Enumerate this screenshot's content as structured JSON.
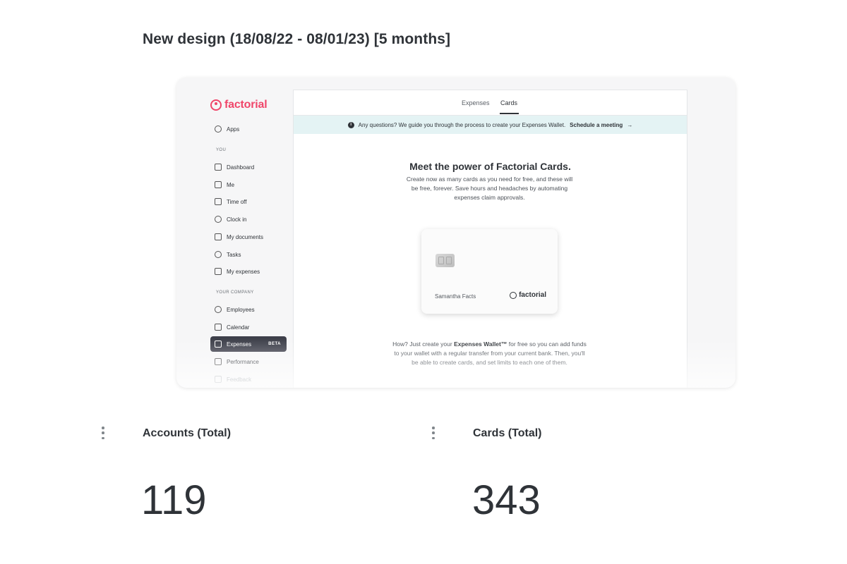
{
  "page": {
    "title": "New design (18/08/22 - 08/01/23) [5 months]"
  },
  "embedded_screenshot": {
    "brand": "factorial",
    "sidebar": {
      "top_item": "Apps",
      "section_you": "YOU",
      "you_items": [
        "Dashboard",
        "Me",
        "Time off",
        "Clock in",
        "My documents",
        "Tasks",
        "My expenses"
      ],
      "section_company": "YOUR COMPANY",
      "company_items": [
        "Employees",
        "Calendar",
        "Expenses",
        "Performance",
        "Feedback"
      ],
      "active_item": "Expenses",
      "active_badge": "BETA"
    },
    "tabs": [
      "Expenses",
      "Cards"
    ],
    "active_tab": "Cards",
    "banner": {
      "text": "Any questions? We guide you through the process to create your Expenses Wallet.",
      "link": "Schedule a meeting",
      "link_arrow": "→"
    },
    "hero": {
      "title": "Meet the power of Factorial Cards.",
      "body": "Create now as many cards as you need for free, and these will be free, forever. Save hours and headaches by automating expenses claim approvals."
    },
    "card": {
      "holder": "Samantha Facts",
      "brand": "factorial"
    },
    "how": {
      "prefix": "How? Just create your ",
      "bold": "Expenses Wallet™",
      "suffix": " for free so you can add funds to your wallet with a regular transfer from your current bank. Then, you'll be able to create cards, and set limits to each one of them."
    }
  },
  "metrics": [
    {
      "label": "Accounts (Total)",
      "value": "119"
    },
    {
      "label": "Cards (Total)",
      "value": "343"
    }
  ],
  "icons": {
    "menu": "kebab-vertical-icon",
    "info": "info-icon"
  }
}
